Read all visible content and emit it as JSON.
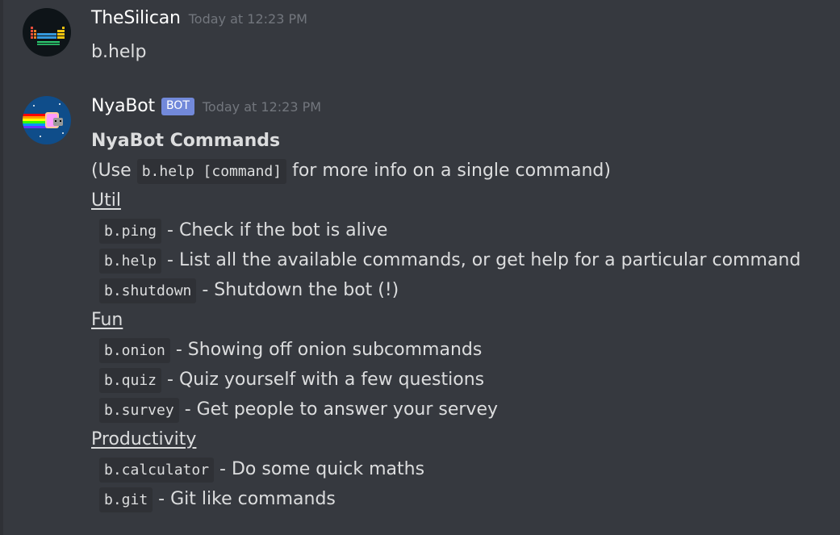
{
  "messages": [
    {
      "username": "TheSilican",
      "timestamp": "Today at 12:23 PM",
      "text": "b.help"
    },
    {
      "username": "NyaBot",
      "bot_tag": "BOT",
      "timestamp": "Today at 12:23 PM",
      "embed_title": "NyaBot Commands",
      "usage": {
        "prefix": "(Use ",
        "code": "b.help [command]",
        "suffix": " for more info on a single command)"
      },
      "categories": [
        {
          "name": "Util",
          "commands": [
            {
              "code": "b.ping",
              "desc": " - Check if the bot is alive"
            },
            {
              "code": "b.help",
              "desc": " - List all the available commands, or get help for a particular command"
            },
            {
              "code": "b.shutdown",
              "desc": " - Shutdown the bot (!)"
            }
          ]
        },
        {
          "name": "Fun",
          "commands": [
            {
              "code": "b.onion",
              "desc": " - Showing off onion subcommands"
            },
            {
              "code": "b.quiz",
              "desc": " - Quiz yourself with a few questions"
            },
            {
              "code": "b.survey",
              "desc": " - Get people to answer your servey"
            }
          ]
        },
        {
          "name": "Productivity",
          "commands": [
            {
              "code": "b.calculator",
              "desc": " - Do some quick maths"
            },
            {
              "code": "b.git",
              "desc": " - Git like commands"
            }
          ]
        }
      ]
    }
  ],
  "colors": {
    "background": "#36393f",
    "code_background": "#2f3136",
    "bot_tag": "#7289da",
    "timestamp": "#72767d",
    "text": "#dcddde"
  }
}
